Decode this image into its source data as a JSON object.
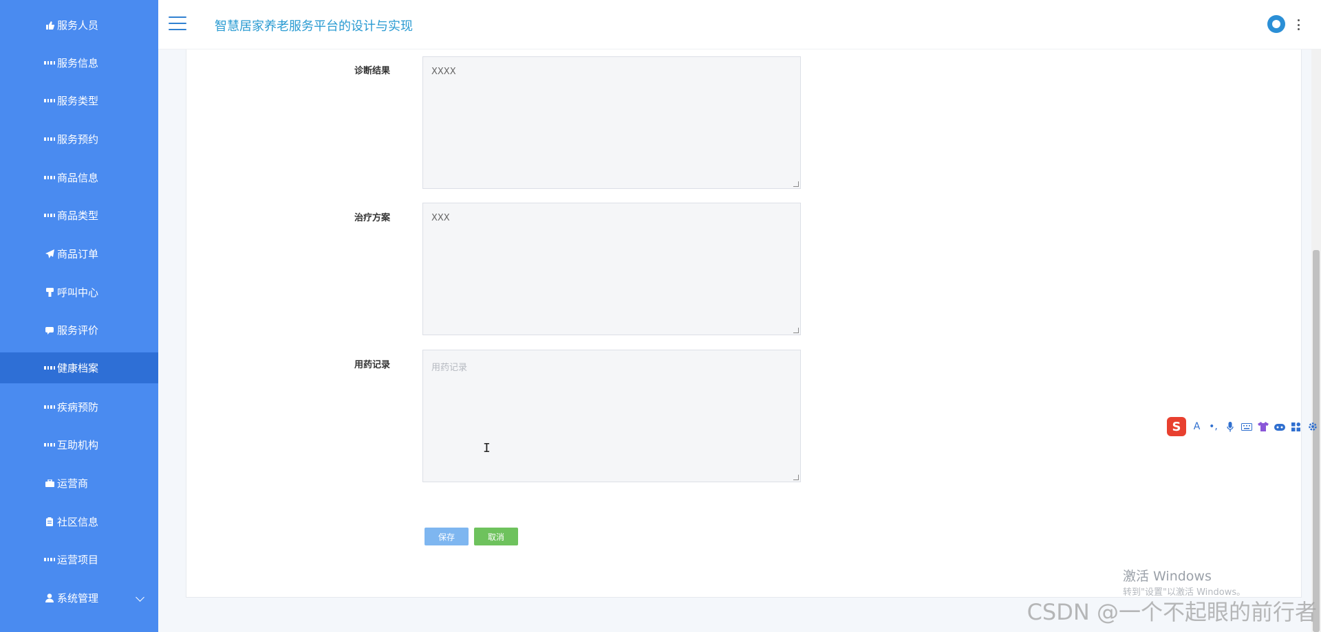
{
  "sidebar": {
    "items": [
      {
        "label": "服务人员",
        "icon": "thumbs-up-icon"
      },
      {
        "label": "服务信息",
        "icon": "grid-icon"
      },
      {
        "label": "服务类型",
        "icon": "grid-icon"
      },
      {
        "label": "服务预约",
        "icon": "grid-icon"
      },
      {
        "label": "商品信息",
        "icon": "grid-icon"
      },
      {
        "label": "商品类型",
        "icon": "grid-icon"
      },
      {
        "label": "商品订单",
        "icon": "paper-plane-icon"
      },
      {
        "label": "呼叫中心",
        "icon": "phone-icon"
      },
      {
        "label": "服务评价",
        "icon": "comment-icon"
      },
      {
        "label": "健康档案",
        "icon": "grid-icon"
      },
      {
        "label": "疾病预防",
        "icon": "grid-icon"
      },
      {
        "label": "互助机构",
        "icon": "grid-icon"
      },
      {
        "label": "运营商",
        "icon": "briefcase-icon"
      },
      {
        "label": "社区信息",
        "icon": "clipboard-icon"
      },
      {
        "label": "运营项目",
        "icon": "grid-icon"
      },
      {
        "label": "系统管理",
        "icon": "user-icon"
      }
    ],
    "active": "健康档案"
  },
  "header": {
    "title": "智慧居家养老服务平台的设计与实现"
  },
  "form": {
    "diagnosis": {
      "label": "诊断结果",
      "value": "XXXX"
    },
    "treatment": {
      "label": "治疗方案",
      "value": "XXX"
    },
    "medication": {
      "label": "用药记录",
      "placeholder": "用药记录",
      "value": ""
    },
    "save_label": "保存",
    "cancel_label": "取消"
  },
  "ime_toolbar": {
    "logo": "S",
    "items": [
      "A",
      "•,",
      "mic-icon",
      "keyboard-icon",
      "shirt-icon",
      "robot-icon",
      "apps-icon",
      "settings-icon"
    ]
  },
  "watermarks": {
    "windows_line1": "激活 Windows",
    "windows_line2": "转到\"设置\"以激活 Windows。",
    "csdn": "CSDN @一个不起眼的前行者"
  },
  "colors": {
    "sidebar": "#4a8bf0",
    "sidebar_active": "#2e6fd6",
    "title": "#2a9bd2",
    "save_button": "#7eb6f0",
    "cancel_button": "#6ec25d"
  }
}
